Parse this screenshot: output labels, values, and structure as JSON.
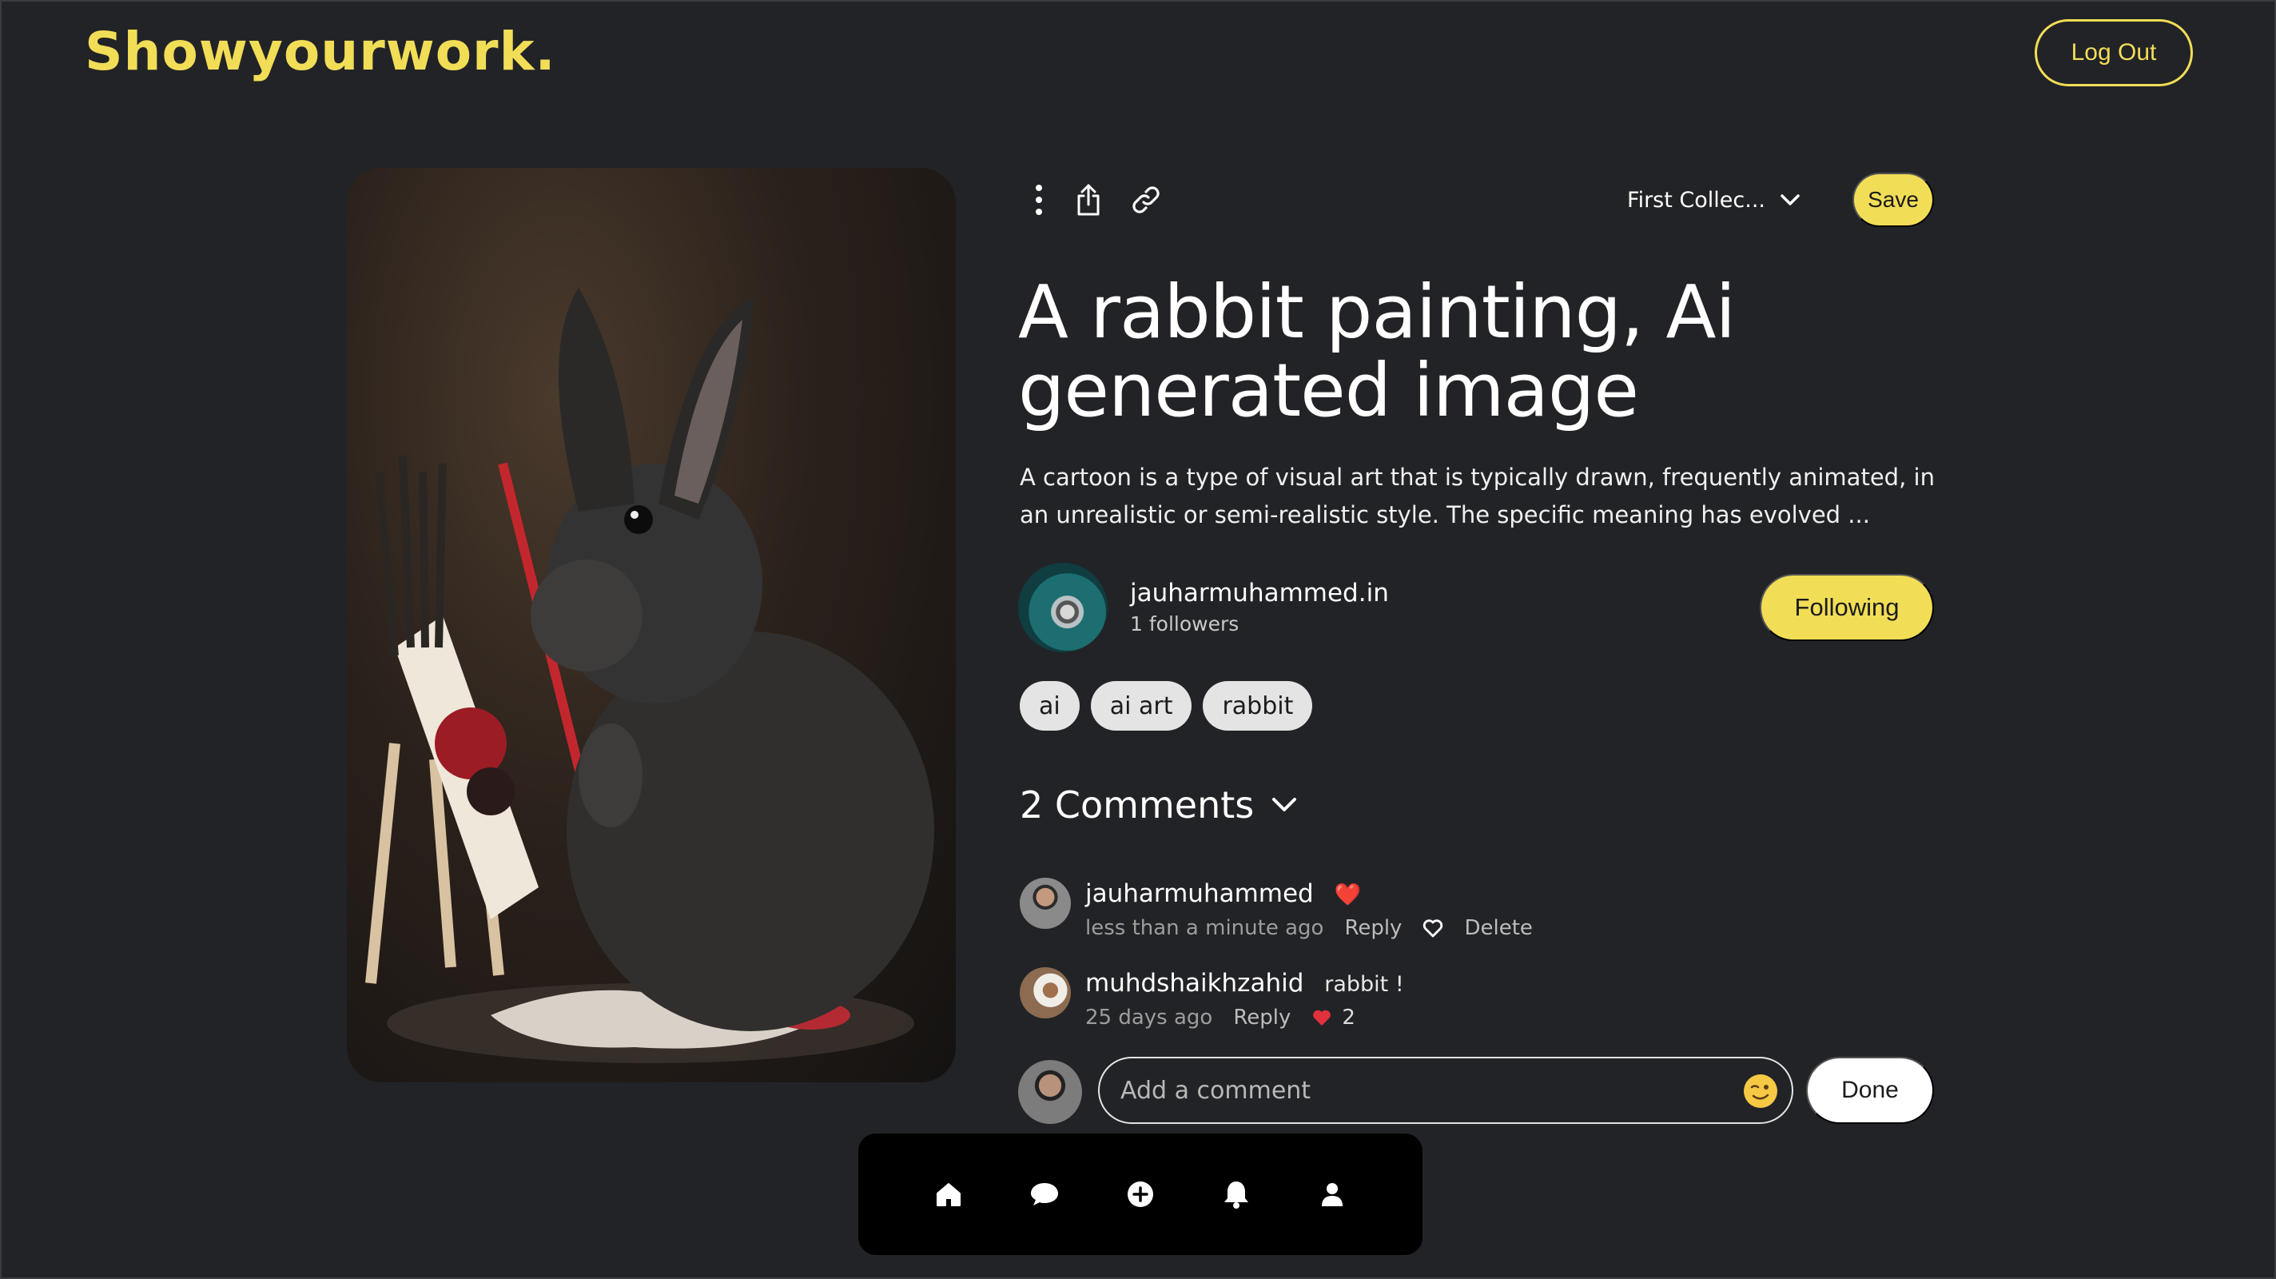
{
  "header": {
    "logo": "Showyourwork.",
    "logout_label": "Log Out"
  },
  "artwork": {
    "icon": "rabbit-painting-image"
  },
  "actions": {
    "more_icon": "more-vertical-icon",
    "share_icon": "share-icon",
    "link_icon": "link-icon",
    "collection_label": "First Collec...",
    "save_label": "Save"
  },
  "post": {
    "title": "A rabbit painting, Ai generated image",
    "description": "A cartoon is a type of visual art that is typically drawn, frequently animated, in an unrealistic or semi-realistic style. The specific meaning has evolved ..."
  },
  "author": {
    "name": "jauharmuhammed.in",
    "followers": "1 followers",
    "follow_label": "Following"
  },
  "tags": [
    "ai",
    "ai art",
    "rabbit"
  ],
  "comments": {
    "header": "2 Comments",
    "items": [
      {
        "user": "jauharmuhammed",
        "text": "❤️",
        "time": "less than a minute ago",
        "reply": "Reply",
        "delete": "Delete",
        "likes": ""
      },
      {
        "user": "muhdshaikhzahid",
        "text": "rabbit !",
        "time": "25 days ago",
        "reply": "Reply",
        "likes": "2"
      }
    ],
    "input_placeholder": "Add a comment",
    "done_label": "Done"
  },
  "nav": [
    "home-icon",
    "chat-icon",
    "add-icon",
    "bell-icon",
    "profile-icon"
  ],
  "colors": {
    "accent": "#f2dd57",
    "background": "#222327",
    "like": "#e0323c"
  }
}
